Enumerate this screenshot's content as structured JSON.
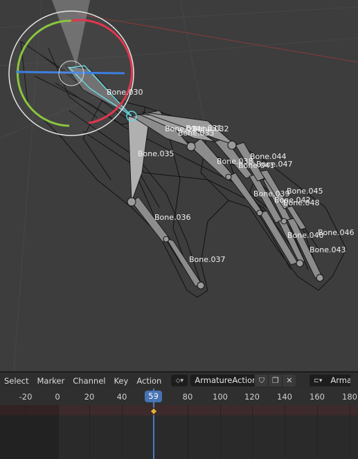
{
  "viewport": {
    "bones": [
      {
        "name": "Bone.030"
      },
      {
        "name": "Bone.034"
      },
      {
        "name": "Bone.031"
      },
      {
        "name": "Bone.032"
      },
      {
        "name": "Bone.033"
      },
      {
        "name": "Bone.035"
      },
      {
        "name": "Bone.044"
      },
      {
        "name": "Bone.038"
      },
      {
        "name": "Bone.047"
      },
      {
        "name": "Bone.041"
      },
      {
        "name": "Bone.045"
      },
      {
        "name": "Bone.039"
      },
      {
        "name": "Bone.042"
      },
      {
        "name": "Bone.048"
      },
      {
        "name": "Bone.036"
      },
      {
        "name": "Bone.046"
      },
      {
        "name": "Bone.040"
      },
      {
        "name": "Bone.043"
      },
      {
        "name": "Bone.037"
      }
    ],
    "gizmo_colors": {
      "x": "#e2364c",
      "y": "#8bc63e",
      "z": "#3d7fe0",
      "highlight": "#5fd7e0"
    }
  },
  "dopesheet": {
    "menus": [
      "Select",
      "Marker",
      "Channel",
      "Key",
      "Action"
    ],
    "action_name": "ArmatureAction",
    "action_name_2": "Arma",
    "icons": [
      "shield-icon",
      "duplicate-icon",
      "close-icon"
    ],
    "current_frame": "59",
    "ticks": [
      "-20",
      "0",
      "20",
      "40",
      "80",
      "100",
      "120",
      "140",
      "160",
      "180"
    ],
    "accent": "#4772b3"
  }
}
